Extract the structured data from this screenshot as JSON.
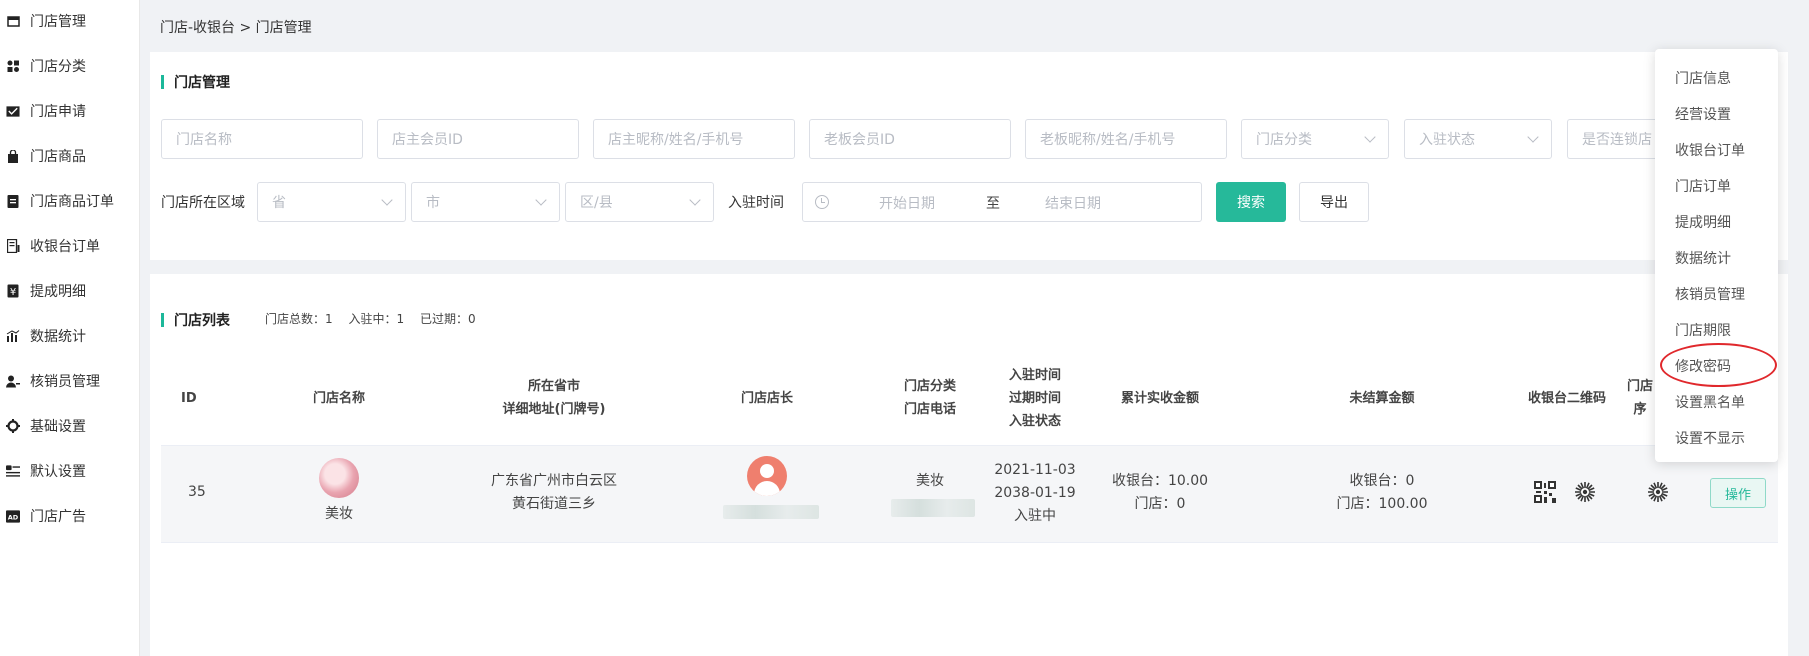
{
  "sidebar": {
    "items": [
      {
        "label": "门店管理",
        "icon": "store-icon"
      },
      {
        "label": "门店分类",
        "icon": "grid-icon"
      },
      {
        "label": "门店申请",
        "icon": "inbox-icon"
      },
      {
        "label": "门店商品",
        "icon": "bag-icon"
      },
      {
        "label": "门店商品订单",
        "icon": "clipboard-icon"
      },
      {
        "label": "收银台订单",
        "icon": "receipt-icon"
      },
      {
        "label": "提成明细",
        "icon": "yen-icon"
      },
      {
        "label": "数据统计",
        "icon": "bar-chart-icon"
      },
      {
        "label": "核销员管理",
        "icon": "user-key-icon"
      },
      {
        "label": "基础设置",
        "icon": "gear-icon"
      },
      {
        "label": "默认设置",
        "icon": "list-icon"
      },
      {
        "label": "门店广告",
        "icon": "ad-icon"
      }
    ]
  },
  "breadcrumb": "门店-收银台 > 门店管理",
  "filter": {
    "title": "门店管理",
    "store_name_placeholder": "门店名称",
    "member_id_placeholder": "店主会员ID",
    "owner_info_placeholder": "店主昵称/姓名/手机号",
    "boss_id_placeholder": "老板会员ID",
    "boss_info_placeholder": "老板昵称/姓名/手机号",
    "category_placeholder": "门店分类",
    "status_placeholder": "入驻状态",
    "chain_placeholder": "是否连锁店",
    "region_label": "门店所在区域",
    "province_placeholder": "省",
    "city_placeholder": "市",
    "district_placeholder": "区/县",
    "time_label": "入驻时间",
    "start_placeholder": "开始日期",
    "range_separator": "至",
    "end_placeholder": "结束日期",
    "search_label": "搜索",
    "export_label": "导出"
  },
  "list": {
    "title": "门店列表",
    "stats": {
      "total": "门店总数：1",
      "active": "入驻中：1",
      "expired": "已过期：0"
    },
    "headers": {
      "id": "ID",
      "name": "门店名称",
      "address_1": "所在省市",
      "address_2": "详细地址(门牌号)",
      "manager": "门店店长",
      "category_1": "门店分类",
      "category_2": "门店电话",
      "time_1": "入驻时间",
      "time_2": "过期时间",
      "time_3": "入驻状态",
      "total_received": "累计实收金额",
      "unsettled": "未结算金额",
      "qr_code": "收银台二维码",
      "store_qr_1": "门店",
      "store_qr_2": "序"
    },
    "row": {
      "id": "35",
      "name": "美妆",
      "address_1": "广东省广州市白云区",
      "address_2": "黄石街道三乡",
      "category": "美妆",
      "join_date": "2021-11-03",
      "expire_date": "2038-01-19",
      "status": "入驻中",
      "received_cashier": "收银台：10.00",
      "received_store": "门店：0",
      "unsettled_cashier": "收银台：0",
      "unsettled_store": "门店：100.00",
      "action_label": "操作"
    }
  },
  "dropdown": {
    "items": [
      "门店信息",
      "经营设置",
      "收银台订单",
      "门店订单",
      "提成明细",
      "数据统计",
      "核销员管理",
      "门店期限",
      "修改密码",
      "设置黑名单",
      "设置不显示"
    ]
  },
  "colors": {
    "accent": "#26b99a",
    "highlight_circle": "#e0282c"
  }
}
